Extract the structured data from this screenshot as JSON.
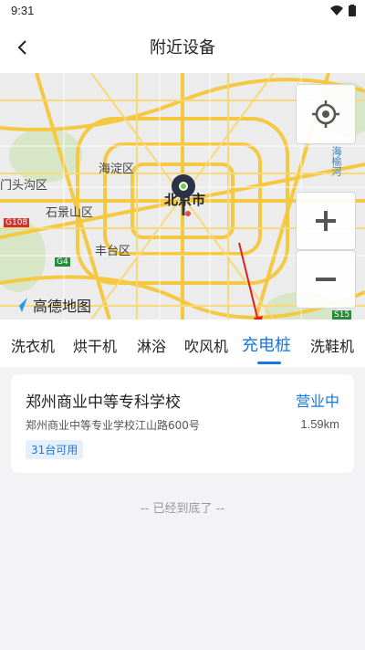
{
  "status_bar": {
    "time": "9:31"
  },
  "header": {
    "title": "附近设备"
  },
  "map": {
    "labels": {
      "haidian": "海淀区",
      "beijing": "北京市",
      "shijingshan": "石景山区",
      "fengtai": "丰台区",
      "mentougou": "门头沟区",
      "shunyi": "海榆河"
    },
    "road_badges": [
      "G108",
      "G4",
      "S15"
    ],
    "logo_text": "高德地图"
  },
  "tabs": [
    {
      "label": "洗衣机"
    },
    {
      "label": "烘干机"
    },
    {
      "label": "淋浴"
    },
    {
      "label": "吹风机"
    },
    {
      "label": "充电桩",
      "active": true
    },
    {
      "label": "洗鞋机"
    }
  ],
  "device": {
    "name": "郑州商业中等专科学校",
    "status": "营业中",
    "address": "郑州商业中等专业学校江山路600号",
    "distance": "1.59km",
    "available": "31台可用"
  },
  "footer": {
    "end_text": "-- 已经到底了 --"
  },
  "colors": {
    "accent": "#1677e5",
    "map_road": "#f5c842",
    "pin": "#2c3245"
  }
}
